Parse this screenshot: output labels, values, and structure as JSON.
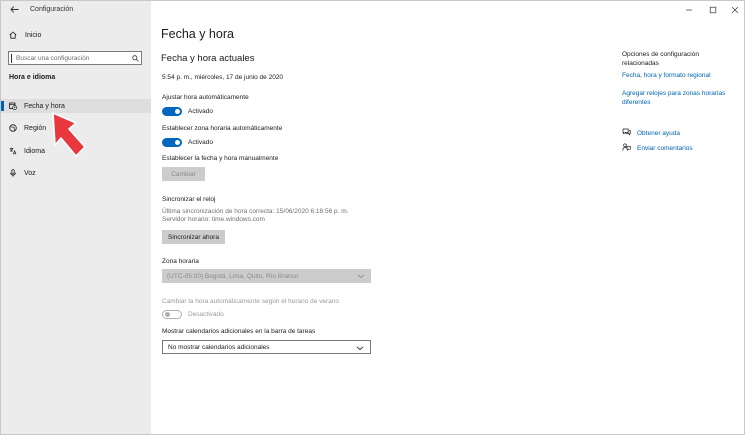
{
  "window": {
    "title": "Configuración",
    "controls": {
      "minimize": "—",
      "maximize": "☐",
      "close": "✕"
    }
  },
  "sidebar": {
    "home_label": "Inicio",
    "search_placeholder": "Buscar una configuración",
    "section_title": "Hora e idioma",
    "items": [
      {
        "label": "Fecha y hora",
        "icon": "calendar-clock-icon",
        "active": true
      },
      {
        "label": "Región",
        "icon": "globe-icon",
        "active": false
      },
      {
        "label": "Idioma",
        "icon": "language-icon",
        "active": false
      },
      {
        "label": "Voz",
        "icon": "microphone-icon",
        "active": false
      }
    ]
  },
  "main": {
    "page_title": "Fecha y hora",
    "section_title": "Fecha y hora actuales",
    "current_datetime": "5:54 p. m., miércoles, 17 de junio de 2020",
    "auto_time": {
      "label": "Ajustar hora automáticamente",
      "state": "Activado"
    },
    "auto_timezone": {
      "label": "Establecer zona horaria automáticamente",
      "state": "Activado"
    },
    "manual": {
      "label": "Establecer la fecha y hora manualmente",
      "button": "Cambiar"
    },
    "sync": {
      "title": "Sincronizar el reloj",
      "last_sync": "Última sincronización de hora correcta: 15/06/2020 6:18:56 p. m.",
      "server": "Servidor horario: time.windows.com",
      "button": "Sincronizar ahora"
    },
    "timezone": {
      "label": "Zona horaria",
      "value": "(UTC-05:00) Bogotá, Lima, Quito, Río Branco"
    },
    "dst": {
      "label": "Cambiar la hora automáticamente según el horario de verano",
      "state": "Desactivado"
    },
    "calendars": {
      "label": "Mostrar calendarios adicionales en la barra de tareas",
      "value": "No mostrar calendarios adicionales"
    }
  },
  "related": {
    "title": "Opciones de configuración relacionadas",
    "links": [
      "Fecha, hora y formato regional",
      "Agregar relojes para zonas horarias diferentes"
    ],
    "help": {
      "label": "Obtener ayuda",
      "icon": "help-chat-icon"
    },
    "feedback": {
      "label": "Enviar comentarios",
      "icon": "feedback-icon"
    }
  },
  "colors": {
    "accent": "#0067c0",
    "link": "#0063b1",
    "sidebar_bg": "#ececec",
    "pointer_arrow": "#e8373d"
  }
}
